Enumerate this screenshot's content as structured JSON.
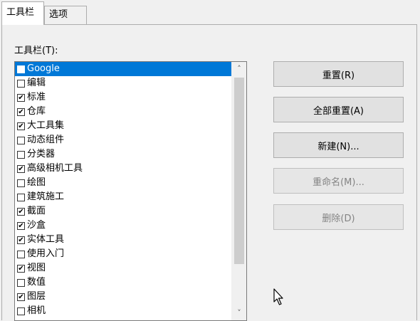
{
  "tabs": [
    {
      "label": "工具栏",
      "active": true
    },
    {
      "label": "选项",
      "active": false
    }
  ],
  "toolbars_label": "工具栏(T):",
  "toolbar_items": [
    {
      "label": "Google",
      "checked": false,
      "selected": true
    },
    {
      "label": "编辑",
      "checked": false,
      "selected": false
    },
    {
      "label": "标准",
      "checked": true,
      "selected": false
    },
    {
      "label": "仓库",
      "checked": true,
      "selected": false
    },
    {
      "label": "大工具集",
      "checked": true,
      "selected": false
    },
    {
      "label": "动态组件",
      "checked": false,
      "selected": false
    },
    {
      "label": "分类器",
      "checked": false,
      "selected": false
    },
    {
      "label": "高级相机工具",
      "checked": true,
      "selected": false
    },
    {
      "label": "绘图",
      "checked": false,
      "selected": false
    },
    {
      "label": "建筑施工",
      "checked": false,
      "selected": false
    },
    {
      "label": "截面",
      "checked": true,
      "selected": false
    },
    {
      "label": "沙盒",
      "checked": true,
      "selected": false
    },
    {
      "label": "实体工具",
      "checked": true,
      "selected": false
    },
    {
      "label": "使用入门",
      "checked": false,
      "selected": false
    },
    {
      "label": "视图",
      "checked": true,
      "selected": false
    },
    {
      "label": "数值",
      "checked": false,
      "selected": false
    },
    {
      "label": "图层",
      "checked": true,
      "selected": false
    },
    {
      "label": "相机",
      "checked": false,
      "selected": false
    }
  ],
  "buttons": {
    "reset": "重置(R)",
    "reset_all": "全部重置(A)",
    "new": "新建(N)...",
    "rename": "重命名(M)...",
    "delete": "删除(D)"
  },
  "scroll_up_glyph": "˄",
  "scroll_down_glyph": "˅",
  "check_glyph": "✔"
}
